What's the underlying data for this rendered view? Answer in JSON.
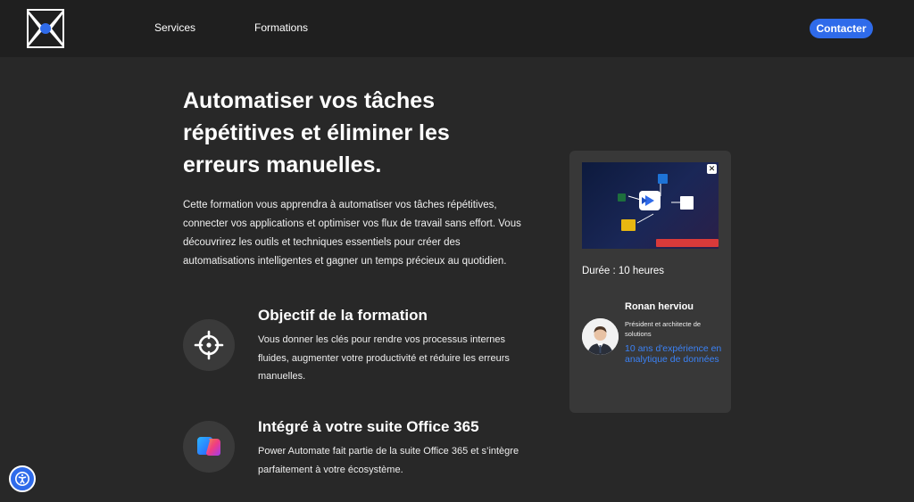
{
  "nav": {
    "logo_icon": "brand-logo-icon",
    "services_label": "Services",
    "formations_label": "Formations",
    "contact_label": "Contacter",
    "accent_color": "#2f6bea"
  },
  "hero": {
    "title": "Automatiser vos tâches répétitives et éliminer les erreurs manuelles.",
    "description": "Cette formation vous apprendra à automatiser vos tâches répétitives, connecter vos applications et optimiser vos flux de travail sans effort. Vous découvrirez les outils et techniques essentiels pour créer des automatisations intelligentes et gagner un temps précieux au quotidien."
  },
  "features": [
    {
      "icon": "crosshair-icon",
      "title": "Objectif de la formation",
      "text": "Vous donner les clés pour rendre vos processus internes fluides, augmenter votre productivité et réduire les erreurs manuelles."
    },
    {
      "icon": "copilot-icon",
      "title": "Intégré à votre suite Office 365",
      "text": "Power Automate fait partie de la suite Office 365 et s’intègre parfaitement à votre écosystème."
    }
  ],
  "card": {
    "thumbnail_icon": "power-automate-flow-icon",
    "close_symbol": "✕",
    "duration": "Durée : 10 heures",
    "trainer": {
      "name": "Ronan herviou",
      "role": "Président et architecte de solutions",
      "experience": "10 ans d'expérience en analytique de données"
    }
  },
  "accessibility": {
    "icon": "accessibility-icon"
  }
}
